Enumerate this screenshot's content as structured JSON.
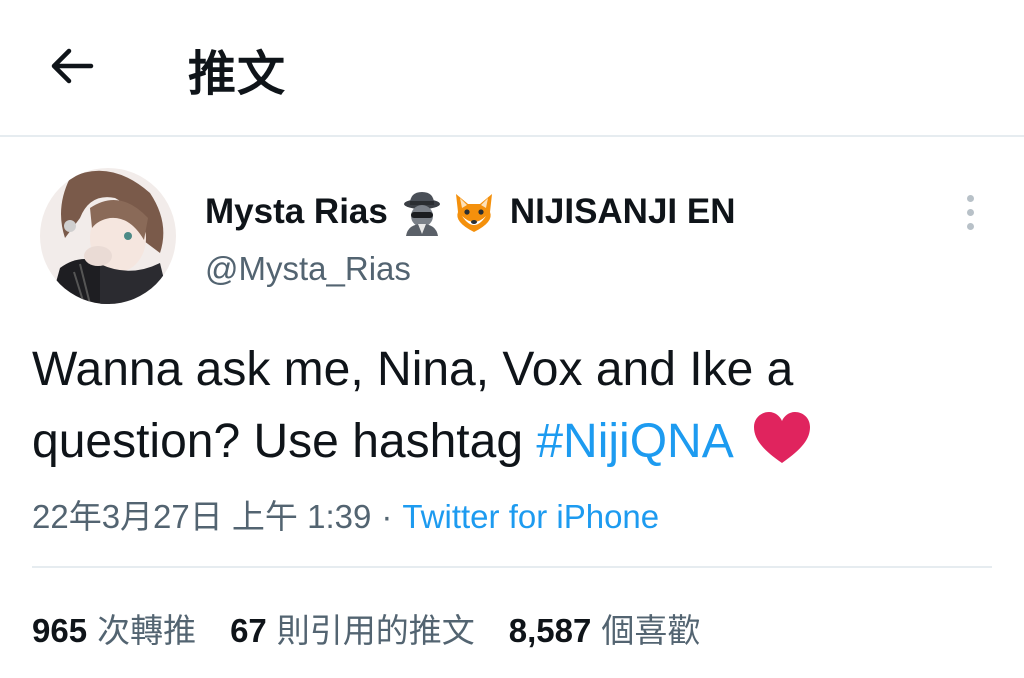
{
  "header": {
    "back_icon": "arrow-left-icon",
    "title": "推文"
  },
  "author": {
    "name": "Mysta Rias",
    "name_emojis": [
      "detective-emoji",
      "fox-emoji"
    ],
    "name_suffix": "NIJISANJI EN",
    "handle": "@Mysta_Rias",
    "avatar": "avatar"
  },
  "tweet": {
    "line1": "Wanna ask me, Nina, Vox and Ike a",
    "line2_prefix": "question? Use hashtag ",
    "hashtag": "#NijiQNA",
    "trailing_emoji": "red-heart-emoji"
  },
  "meta": {
    "timestamp": "22年3月27日 上午 1:39",
    "separator": "·",
    "source": "Twitter for iPhone"
  },
  "stats": [
    {
      "count": "965",
      "label": "次轉推"
    },
    {
      "count": "67",
      "label": "則引用的推文"
    },
    {
      "count": "8,587",
      "label": "個喜歡"
    }
  ],
  "colors": {
    "accent": "#1d9bf0",
    "text_primary": "#0f1419",
    "text_secondary": "#536471",
    "divider": "#e6ecf0",
    "heart": "#e0245e"
  }
}
